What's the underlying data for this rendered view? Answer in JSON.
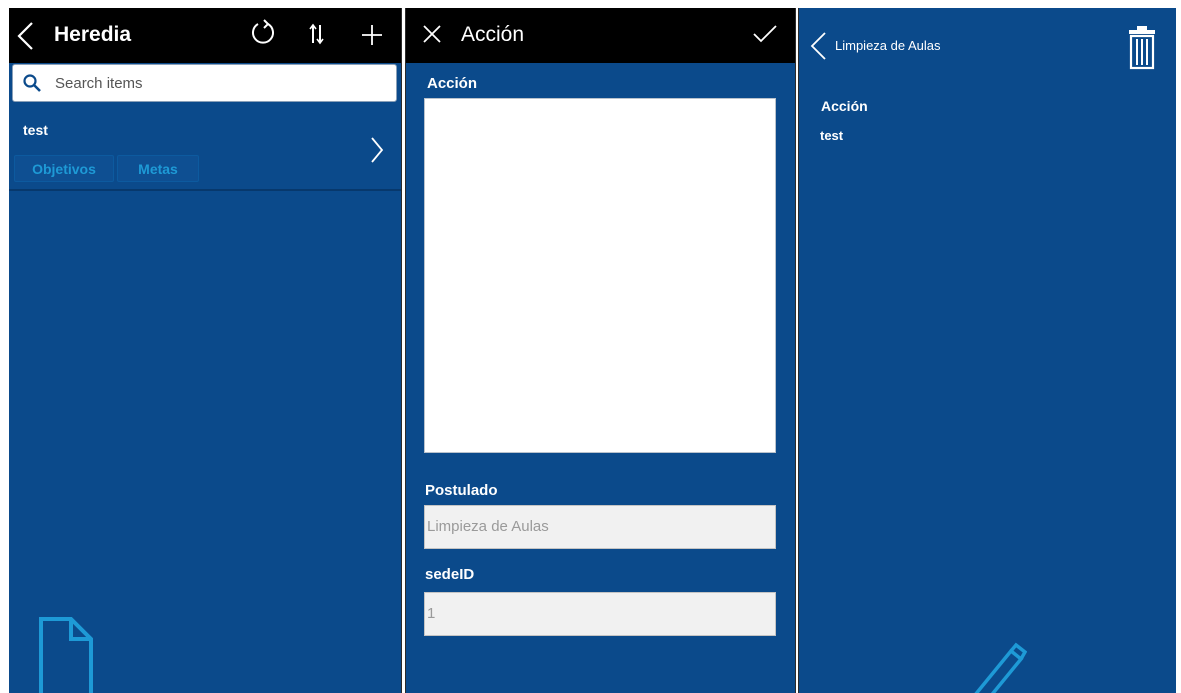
{
  "list_screen": {
    "title": "Heredia",
    "search_placeholder": "Search items",
    "items": [
      {
        "title": "test",
        "links": [
          "Objetivos",
          "Metas"
        ]
      }
    ]
  },
  "edit_screen": {
    "title": "Acción",
    "fields": [
      {
        "label": "Acción",
        "value": ""
      },
      {
        "label": "Postulado",
        "value": "Limpieza de Aulas"
      },
      {
        "label": "sedeID",
        "value": "1"
      }
    ]
  },
  "detail_screen": {
    "title": "Limpieza de Aulas",
    "field_label": "Acción",
    "field_value": "test"
  },
  "colors": {
    "background": "#0b4a8b",
    "header": "#000000",
    "accent": "#1e9ad6"
  },
  "icons": [
    "back-icon",
    "refresh-icon",
    "sort-icon",
    "add-icon",
    "search-icon",
    "chevron-right-icon",
    "close-icon",
    "check-icon",
    "trash-icon",
    "document-icon",
    "pencil-icon"
  ]
}
